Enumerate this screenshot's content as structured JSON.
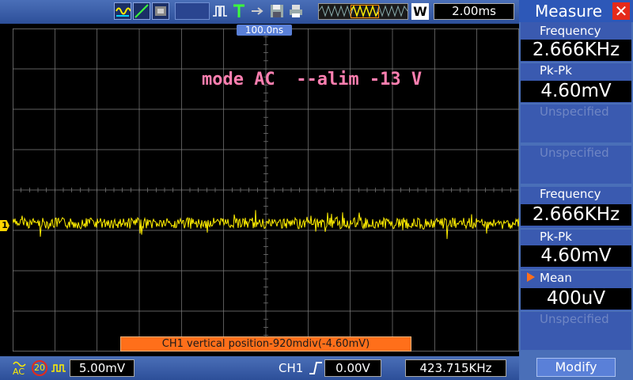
{
  "toolbar": {
    "icons": [
      "ac-coupling-icon",
      "ramp-icon",
      "persistence-icon"
    ],
    "run_icons": [
      "pulse-icon",
      "trigger-t-icon",
      "arrow-icon",
      "save-icon",
      "print-icon"
    ],
    "w_label": "W",
    "timebase": "2.00ms"
  },
  "screen": {
    "trigger_position": "100.0ns",
    "annotation": "mode AC  --alim -13 V",
    "channel_marker": "1",
    "message": "CH1 vertical position-920mdiv(-4.60mV)",
    "trace_color": "#ffee00",
    "grid_color": "#808080"
  },
  "statusbar": {
    "coupling": "AC",
    "bw_limit": "20",
    "ch1_scale": "5.00mV",
    "trigger_source": "CH1",
    "trigger_level": "0.00V",
    "frequency_counter": "423.715KHz"
  },
  "measure": {
    "title": "Measure",
    "slots": [
      {
        "label": "Frequency",
        "value": "2.666KHz"
      },
      {
        "label": "Pk-Pk",
        "value": "4.60mV"
      },
      {
        "label": "Unspecified",
        "value": ""
      },
      {
        "label": "Unspecified",
        "value": ""
      },
      {
        "label": "Frequency",
        "value": "2.666KHz"
      },
      {
        "label": "Pk-Pk",
        "value": "4.60mV"
      },
      {
        "label": "Mean",
        "value": "400uV"
      },
      {
        "label": "Unspecified",
        "value": ""
      }
    ],
    "modify_label": "Modify",
    "accent": "#ff6f1a"
  }
}
